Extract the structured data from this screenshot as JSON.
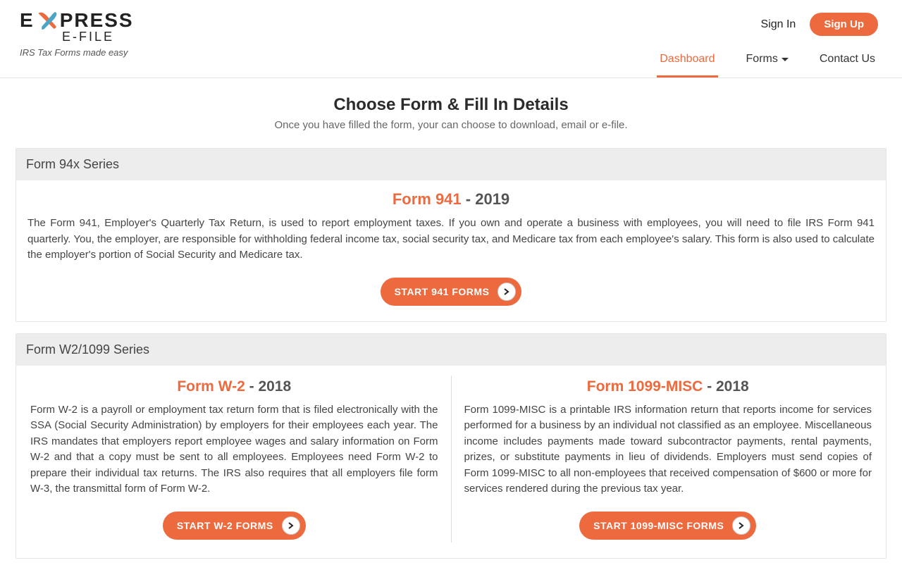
{
  "brand": {
    "wordmark_left": "E",
    "wordmark_right": "PRESS",
    "subline": "E-FILE",
    "tagline": "IRS Tax Forms made easy"
  },
  "auth": {
    "signin": "Sign In",
    "signup": "Sign Up"
  },
  "nav": {
    "dashboard": "Dashboard",
    "forms": "Forms",
    "contact": "Contact Us"
  },
  "hero": {
    "title": "Choose Form & Fill In Details",
    "subtitle": "Once you have filled the form, your can choose to download, email or e-file."
  },
  "section94x": {
    "heading": "Form 94x Series",
    "form941": {
      "name": "Form 941",
      "dash": " - ",
      "year": "2019",
      "desc": "The Form 941, Employer's Quarterly Tax Return, is used to report employment taxes. If you own and operate a business with employees, you will need to file IRS Form 941 quarterly. You, the employer, are responsible for withholding federal income tax, social security tax, and Medicare tax from each employee's salary. This form is also used to calculate the employer's portion of Social Security and Medicare tax.",
      "button": "START 941 FORMS"
    }
  },
  "sectionW2": {
    "heading": "Form W2/1099 Series",
    "w2": {
      "name": "Form W-2",
      "dash": " - ",
      "year": "2018",
      "desc": "Form W-2 is a payroll or employment tax return form that is filed electronically with the SSA (Social Security Administration) by employers for their employees each year. The IRS mandates that employers report employee wages and salary information on Form W-2 and that a copy must be sent to all employees. Employees need Form W-2 to prepare their individual tax returns. The IRS also requires that all employers file form W-3, the transmittal form of Form W-2.",
      "button": "START W-2 FORMS"
    },
    "m1099": {
      "name": "Form 1099-MISC",
      "dash": " - ",
      "year": "2018",
      "desc": "Form 1099-MISC is a printable IRS information return that reports income for services performed for a business by an individual not classified as an employee. Miscellaneous income includes payments made toward subcontractor payments, rental payments, prizes, or substitute payments in lieu of dividends. Employers must send copies of Form 1099-MISC to all non-employees that received compensation of $600 or more for services rendered during the previous tax year.",
      "button": "START 1099-MISC FORMS"
    }
  }
}
